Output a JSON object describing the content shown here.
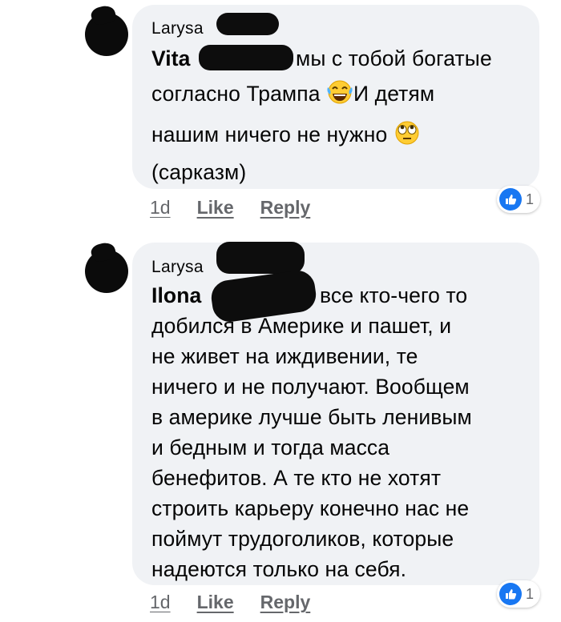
{
  "colors": {
    "bubble": "#f0f2f5",
    "like": "#1877f2",
    "meta": "#65676b",
    "text": "#050505"
  },
  "comments": [
    {
      "author": "Larysa",
      "mention": "Vita",
      "lines": [
        "мы с тобой богатые",
        "согласно Трампа",
        "И детям",
        "нашим ничего не нужно",
        "(сарказм)"
      ],
      "emojis": [
        "tears-of-joy-emoji-icon",
        "eye-roll-emoji-icon"
      ],
      "time": "1d",
      "like_label": "Like",
      "reply_label": "Reply",
      "reaction_icon": "like-reaction-icon",
      "reaction_count": "1"
    },
    {
      "author": "Larysa",
      "mention": "Ilona",
      "lines": [
        "все кто-чего то",
        "добился в Америке и пашет, и",
        "не живет на иждивении, те",
        "ничего и не получают. Вообщем",
        "в америке лучше быть ленивым",
        "и бедным и тогда масса",
        "бенефитов. А те кто не хотят",
        "строить карьеру конечно нас не",
        "поймут трудоголиков, которые",
        "надеются только на себя."
      ],
      "time": "1d",
      "like_label": "Like",
      "reply_label": "Reply",
      "reaction_icon": "like-reaction-icon",
      "reaction_count": "1"
    }
  ]
}
